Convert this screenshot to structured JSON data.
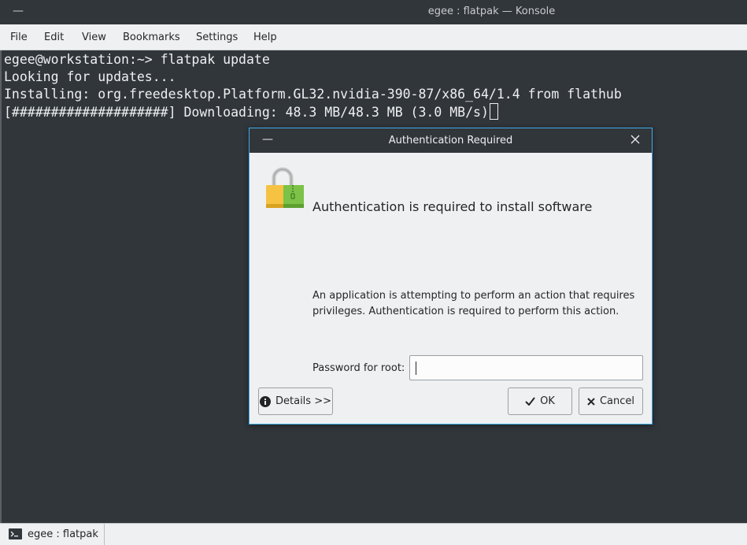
{
  "window": {
    "title": "egee : flatpak — Konsole",
    "minimize_glyph": "—"
  },
  "menu": [
    "File",
    "Edit",
    "View",
    "Bookmarks",
    "Settings",
    "Help"
  ],
  "terminal": {
    "lines": [
      "egee@workstation:~> flatpak update",
      "Looking for updates...",
      "Installing: org.freedesktop.Platform.GL32.nvidia-390-87/x86_64/1.4 from flathub",
      "[####################] Downloading: 48.3 MB/48.3 MB (3.0 MB/s)"
    ]
  },
  "dialog": {
    "title": "Authentication Required",
    "minimize_glyph": "—",
    "heading": "Authentication is required to install software",
    "description": "An application is attempting to perform an action that requires privileges. Authentication is required to perform this action.",
    "password_label": "Password for root:",
    "password_value": "",
    "details_label": "Details >>",
    "ok_label": "OK",
    "cancel_label": "Cancel"
  },
  "taskbar": {
    "item_label": "egee : flatpak"
  },
  "colors": {
    "terminal_bg": "#31363b",
    "accent": "#3daee9",
    "lock_gold": "#f5c242",
    "zip_green": "#7cc248"
  }
}
